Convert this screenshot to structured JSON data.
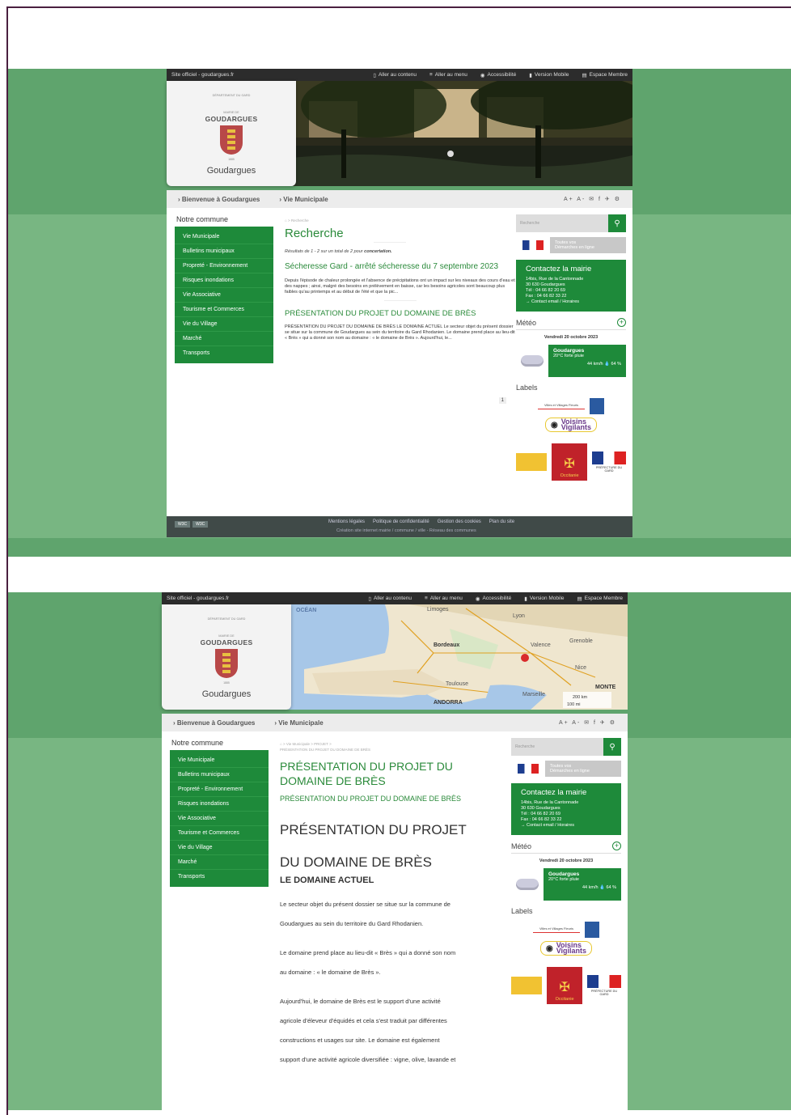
{
  "shot1": {
    "topbar": {
      "site": "Site officiel - goudargues.fr",
      "links": [
        "Aller au contenu",
        "Aller au menu",
        "Accessibilité",
        "Version Mobile",
        "Espace Membre"
      ]
    },
    "logo": {
      "dept": "DÉPARTEMENT DU GARD",
      "mairie": "MAIRIE DE",
      "muni": "GOUDARGUES",
      "tiny": "1885",
      "name": "Goudargues"
    },
    "nav": [
      "Bienvenue à Goudargues",
      "Vie Municipale"
    ],
    "tools": "A+ A- ✉ f ✈ ⚙",
    "left": {
      "heading": "Notre commune",
      "menu": [
        "Vie Municipale",
        "Bulletins municipaux",
        "Propreté - Environnement",
        "Risques inondations",
        "Vie Associative",
        "Tourisme et Commerces",
        "Vie du Village",
        "Marché",
        "Transports"
      ]
    },
    "center": {
      "crumb": "⌂ > Recherche",
      "title": "Recherche",
      "results_prefix": "Résultats de 1 - 2 sur un total de 2 pour",
      "results_term": "concertation.",
      "r1_title": "Sécheresse Gard - arrêté sécheresse du 7 septembre 2023",
      "r1_text": "Depuis l'épisode de chaleur prolongée et l'absence de précipitations ont un impact sur les niveaux des cours d'eau et des nappes ; ainsi, malgré des besoins en prélèvement en baisse, car les besoins agricoles sont beaucoup plus faibles qu'au printemps et au début de l'été et que la pic...",
      "r2_title": "PRÉSENTATION DU PROJET DU DOMAINE DE BRÈS",
      "r2_text": "PRÉSENTATION DU PROJET DU DOMAINE DE BRÈS LE DOMAINE ACTUEL Le secteur objet du présent dossier se situe sur la commune de Goudargues au sein du territoire du Gard Rhodanien. Le domaine prend place au lieu-dit « Brès » qui a donné son nom au domaine : « le domaine de Brès ». Aujourd'hui, le...",
      "page": "1"
    },
    "right": {
      "search_placeholder": "Recherche",
      "demarches_1": "Toutes vos",
      "demarches_2": "Démarches en ligne",
      "contact_title": "Contactez la mairie",
      "contact_lines": [
        "14bis, Rue de la Cantonnade",
        "30 630 Goudargues",
        "Tél : 04 66 82 20 69",
        "Fax : 04 66 82 33 22",
        "→ Contact email / Horaires"
      ],
      "meteo": "Météo",
      "date": "Vendredi 20 octobre 2023",
      "wcity": "Goudargues",
      "wdesc": "20°C forte pluie",
      "wind": "44 km/h 💧 64 %",
      "labels": "Labels",
      "vvf": "Villes et Villages Fleuris",
      "voisins": "Voisins",
      "vigilants": "Vigilants",
      "occitanie": "Occitanie",
      "prefecture": "PRÉFECTURE DU GARD"
    },
    "footer": {
      "links": [
        "Mentions légales",
        "Politique de confidentialité",
        "Gestion des cookies",
        "Plan du site"
      ],
      "sub": "Création site internet mairie / commune / ville - Réseau des communes"
    }
  },
  "shot2": {
    "crumb1": "⌂ > Vie Municipale > PROJET >",
    "crumb2": "PRÉSENTATION DU PROJET DU DOMAINE DE BRÈS",
    "title": "PRÉSENTATION DU PROJET DU DOMAINE DE BRÈS",
    "subtitle": "PRÉSENTATION DU PROJET DU DOMAINE DE BRÈS",
    "h1a": "PRÉSENTATION DU PROJET",
    "h1b": "DU DOMAINE DE BRÈS",
    "h2": "LE DOMAINE ACTUEL",
    "paras": [
      "Le secteur objet du présent dossier se situe sur la commune de",
      "Goudargues au sein du territoire du Gard Rhodanien.",
      "",
      "Le domaine prend place au lieu-dit « Brès » qui a donné son nom",
      "au domaine : « le domaine de Brès ».",
      "",
      "Aujourd'hui, le domaine de Brès est le support d'une activité",
      "agricole d'éleveur d'équidés et cela s'est traduit par différentes",
      "constructions et usages sur site. Le domaine est également",
      "support d'une activité agricole diversifiée : vigne, olive, lavande et"
    ],
    "map_labels": [
      "OCÉAN",
      "Limoges",
      "Lyon",
      "Bordeaux",
      "Grenoble",
      "Valence",
      "Nice",
      "Toulouse",
      "Marseille",
      "ANDORRA",
      "MONTE",
      "200 km",
      "100 mi"
    ]
  }
}
